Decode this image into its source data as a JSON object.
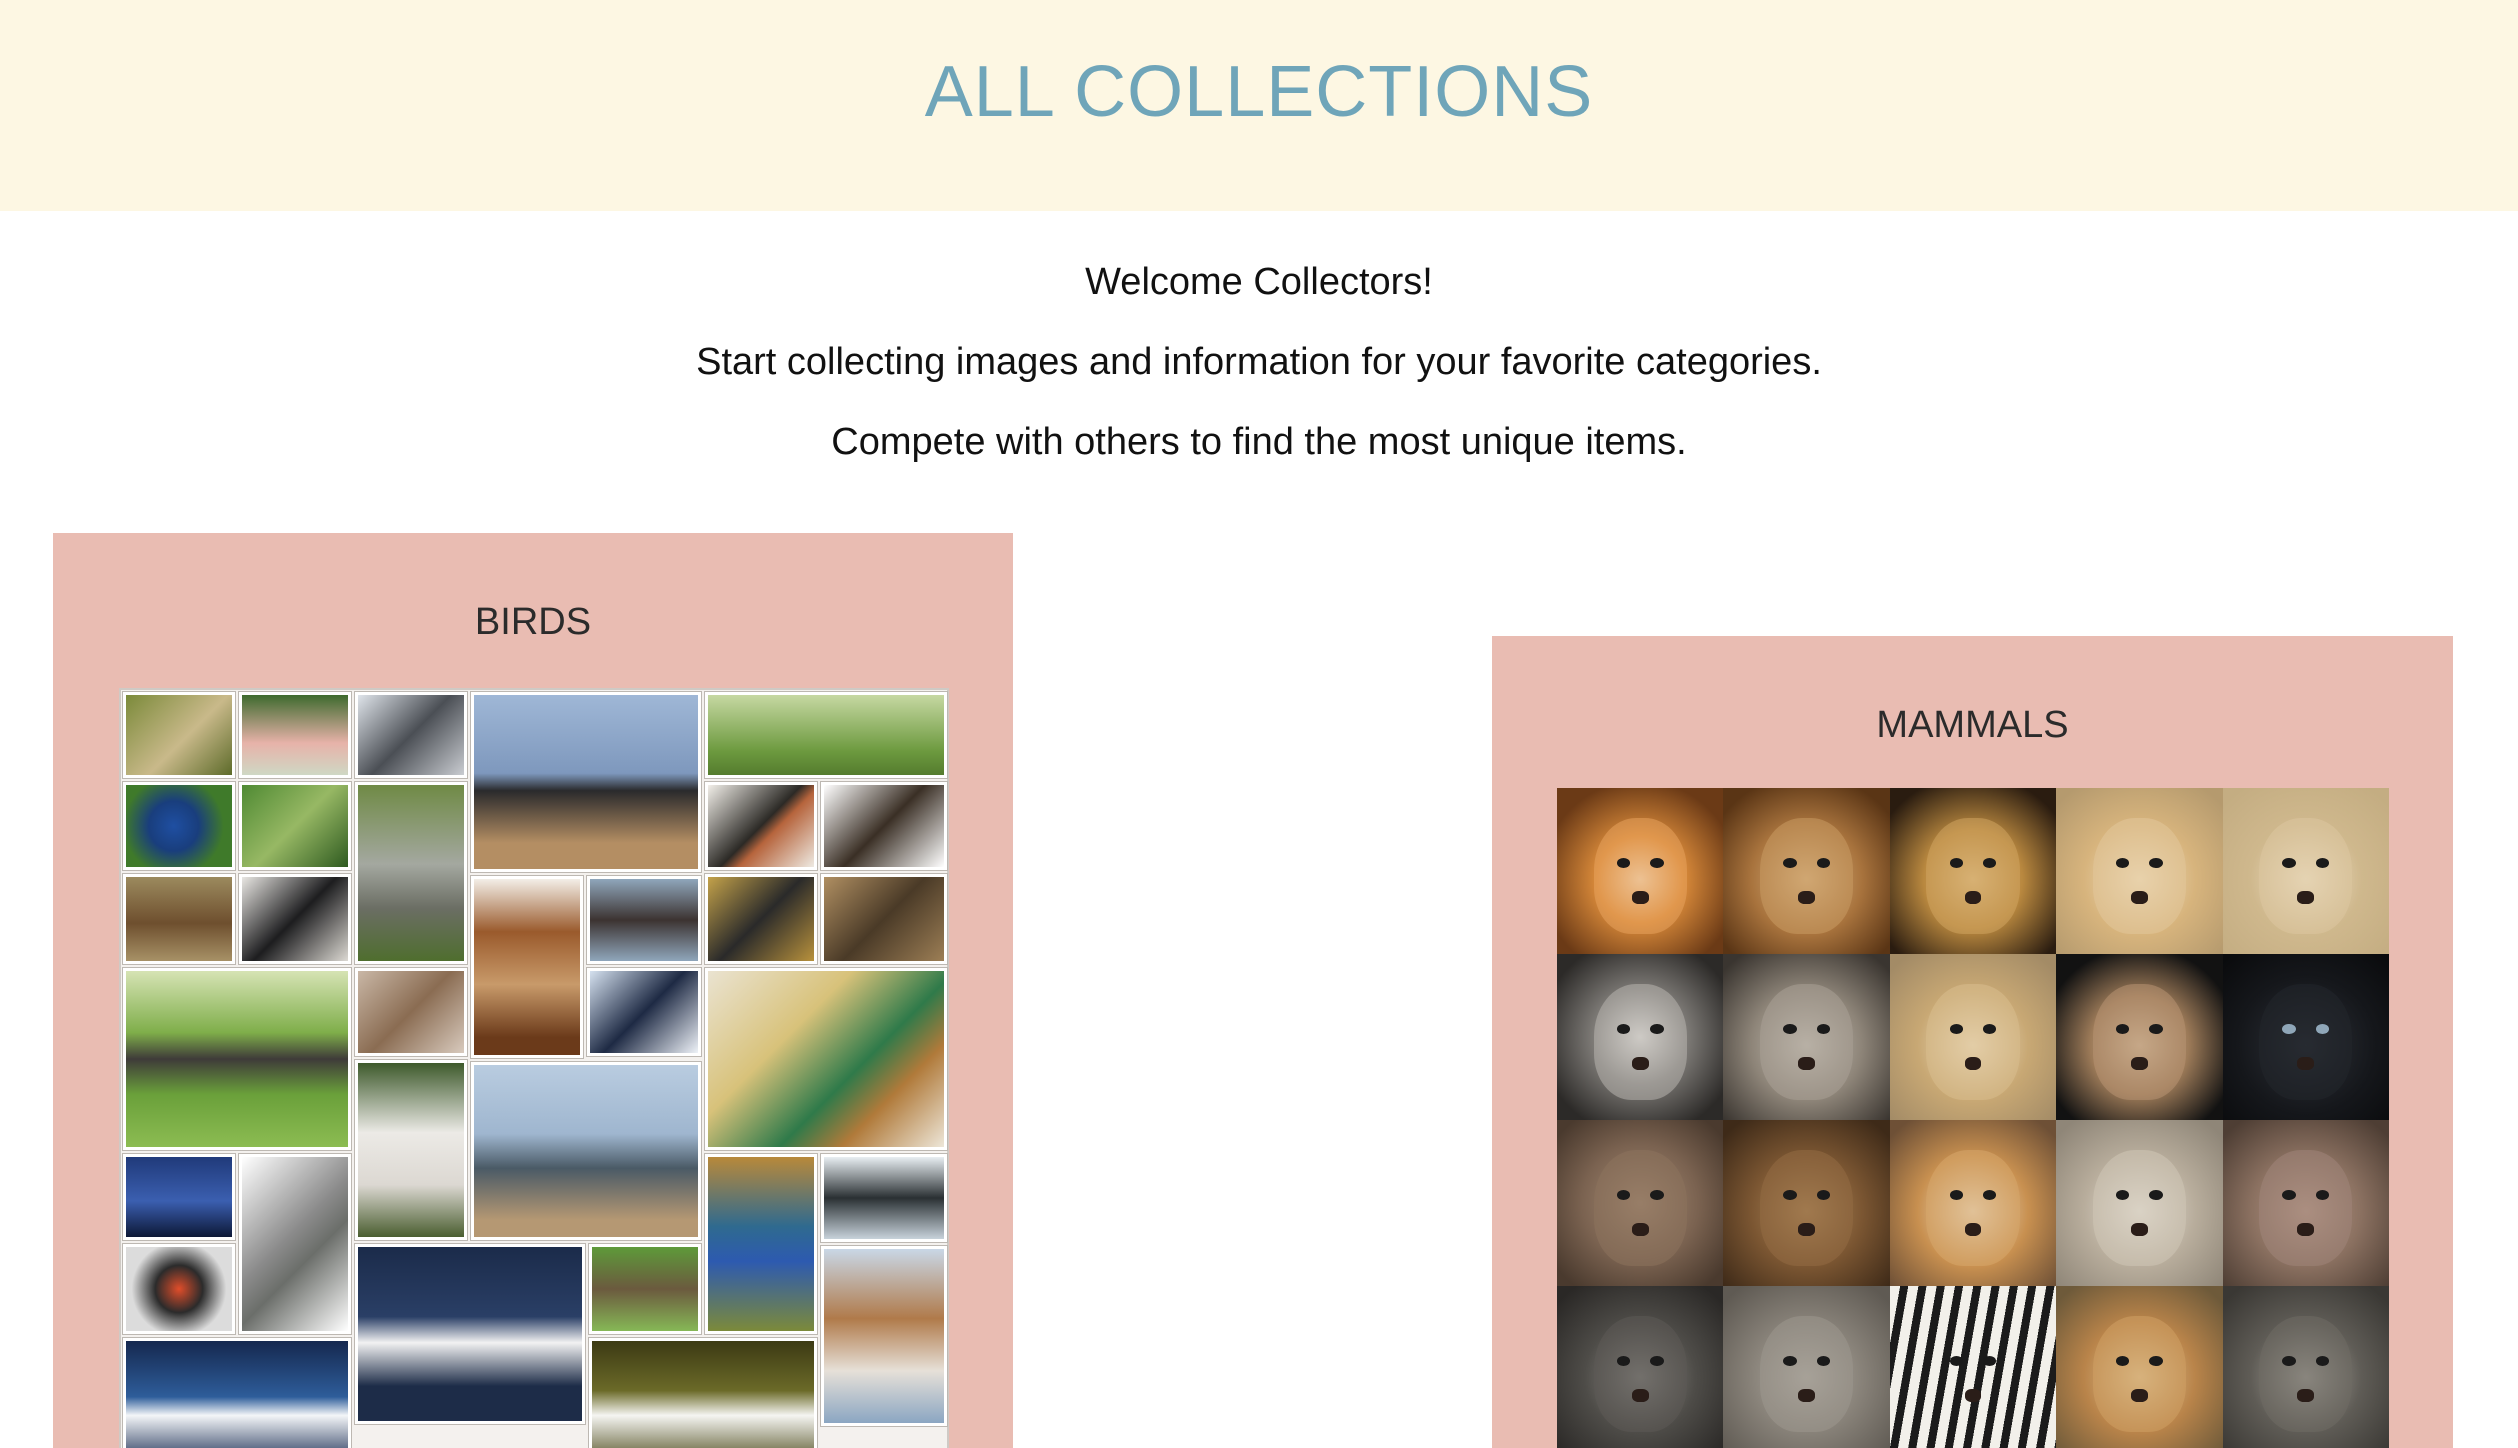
{
  "header": {
    "title": "ALL COLLECTIONS"
  },
  "intro": {
    "line1": "Welcome Collectors!",
    "line2": "Start collecting images and information for your favorite categories.",
    "line3": "Compete with others to find the most unique items."
  },
  "collections": {
    "birds": {
      "title": "BIRDS"
    },
    "mammals": {
      "title": "MAMMALS"
    }
  },
  "colors": {
    "banner_bg": "#fdf7e3",
    "title_color": "#6fa5b9",
    "card_bg": "#e9bcb2"
  }
}
